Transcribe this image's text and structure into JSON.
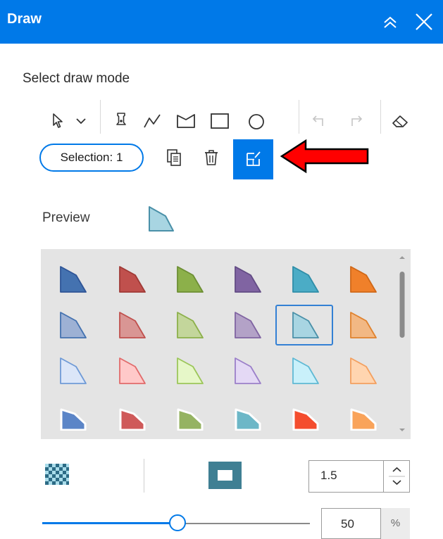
{
  "panel": {
    "title": "Draw",
    "collapse_icon": "double-chevron-up-icon",
    "close_icon": "close-icon"
  },
  "draw_mode": {
    "label": "Select draw mode",
    "tools": [
      {
        "name": "select-tool",
        "icon": "cursor-icon"
      },
      {
        "name": "select-dropdown",
        "icon": "chevron-down-icon"
      },
      {
        "name": "point-tool",
        "icon": "pushpin-icon"
      },
      {
        "name": "polyline-tool",
        "icon": "polyline-icon"
      },
      {
        "name": "polygon-tool",
        "icon": "polygon-icon"
      },
      {
        "name": "rectangle-tool",
        "icon": "rectangle-icon"
      },
      {
        "name": "circle-tool",
        "icon": "circle-icon"
      },
      {
        "name": "undo-button",
        "icon": "undo-icon",
        "enabled": false
      },
      {
        "name": "redo-button",
        "icon": "redo-icon",
        "enabled": false
      },
      {
        "name": "clear-button",
        "icon": "eraser-icon"
      }
    ]
  },
  "selection": {
    "pill_label": "Selection: 1",
    "copy_icon": "copy-icon",
    "delete_icon": "trash-icon",
    "edit_icon": "edit-geometry-icon",
    "edit_active_color": "#0079e8"
  },
  "annotation": {
    "arrow_color": "#ff0000"
  },
  "preview": {
    "label": "Preview",
    "fill": "#a8d5e2",
    "stroke": "#4a90a8"
  },
  "gallery": {
    "selected_index": 10,
    "rows": [
      [
        {
          "fill": "#4472b0",
          "stroke": "#2f5597"
        },
        {
          "fill": "#c0504d",
          "stroke": "#a03a36"
        },
        {
          "fill": "#8cb04a",
          "stroke": "#6d8f34"
        },
        {
          "fill": "#8064a2",
          "stroke": "#634c85"
        },
        {
          "fill": "#4bacc6",
          "stroke": "#2f8ea8"
        },
        {
          "fill": "#f0802a",
          "stroke": "#d06818"
        }
      ],
      [
        {
          "fill": "#9db1d4",
          "stroke": "#4472b0"
        },
        {
          "fill": "#d99694",
          "stroke": "#c0504d"
        },
        {
          "fill": "#c3d69b",
          "stroke": "#8cb04a"
        },
        {
          "fill": "#b3a2c7",
          "stroke": "#8064a2"
        },
        {
          "fill": "#a8d5e2",
          "stroke": "#4a90a8"
        },
        {
          "fill": "#f2b884",
          "stroke": "#e0822e"
        }
      ],
      [
        {
          "fill": "#dbe6f8",
          "stroke": "#6f9ad6"
        },
        {
          "fill": "#ffc9c9",
          "stroke": "#e16b6b"
        },
        {
          "fill": "#e6f7c8",
          "stroke": "#9cc65a"
        },
        {
          "fill": "#e4d9f5",
          "stroke": "#9b7fc9"
        },
        {
          "fill": "#c9f0fa",
          "stroke": "#5fb9d4"
        },
        {
          "fill": "#ffd5b0",
          "stroke": "#f3a060"
        }
      ],
      [
        {
          "fill": "#5b85c7",
          "stroke": "#ffffff"
        },
        {
          "fill": "#cf5a5a",
          "stroke": "#ffffff"
        },
        {
          "fill": "#95b362",
          "stroke": "#ffffff"
        },
        {
          "fill": "#6cb7c7",
          "stroke": "#ffffff"
        },
        {
          "fill": "#f44d2e",
          "stroke": "#ffffff"
        },
        {
          "fill": "#f9a35a",
          "stroke": "#ffffff"
        }
      ]
    ]
  },
  "style_controls": {
    "fill_pattern_icon": "checker-fill-icon",
    "outline_color": "#3f7f93",
    "outline_width": "1.5",
    "step_up_icon": "chevron-up-icon",
    "step_down_icon": "chevron-down-icon",
    "transparency_value": "50",
    "transparency_unit": "%",
    "transparency_level": 50
  }
}
